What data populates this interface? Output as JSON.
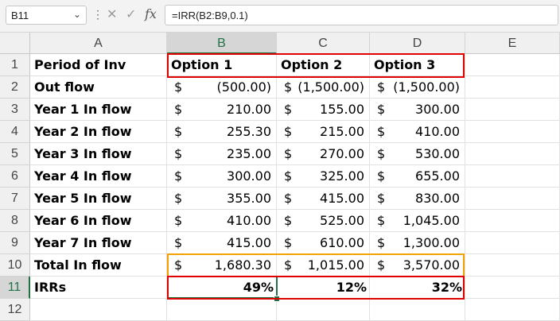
{
  "formula_bar": {
    "name_box": "B11",
    "name_box_chevron_icon": "chevron-down-icon",
    "more_icon": "vertical-ellipsis-icon",
    "cancel_icon": "close-icon",
    "enter_icon": "checkmark-icon",
    "fx_label": "fx",
    "formula": "=IRR(B2:B9,0.1)"
  },
  "columns": [
    "A",
    "B",
    "C",
    "D",
    "E"
  ],
  "rows": [
    "1",
    "2",
    "3",
    "4",
    "5",
    "6",
    "7",
    "8",
    "9",
    "10",
    "11",
    "12"
  ],
  "sheet": {
    "header_row": [
      "Period of Inv",
      "Option 1",
      "Option 2",
      "Option 3"
    ],
    "currency_symbol": "$",
    "data_rows": [
      {
        "label": "Out flow",
        "values": [
          "(500.00)",
          "(1,500.00)",
          "(1,500.00)"
        ]
      },
      {
        "label": "Year 1 In flow",
        "values": [
          "210.00",
          "155.00",
          "300.00"
        ]
      },
      {
        "label": "Year 2 In flow",
        "values": [
          "255.30",
          "215.00",
          "410.00"
        ]
      },
      {
        "label": "Year 3 In flow",
        "values": [
          "235.00",
          "270.00",
          "530.00"
        ]
      },
      {
        "label": "Year 4 In flow",
        "values": [
          "300.00",
          "325.00",
          "655.00"
        ]
      },
      {
        "label": "Year 5 In flow",
        "values": [
          "355.00",
          "415.00",
          "830.00"
        ]
      },
      {
        "label": "Year 6 In flow",
        "values": [
          "410.00",
          "525.00",
          "1,045.00"
        ]
      },
      {
        "label": "Year 7 In flow",
        "values": [
          "415.00",
          "610.00",
          "1,300.00"
        ]
      },
      {
        "label": "Total In flow",
        "values": [
          "1,680.30",
          "1,015.00",
          "3,570.00"
        ]
      }
    ],
    "irr_row": {
      "label": "IRRs",
      "values": [
        "49%",
        "12%",
        "32%"
      ]
    }
  },
  "colors": {
    "highlight_red": "#e00000",
    "highlight_orange": "#f2a100",
    "selection_green": "#217346"
  }
}
